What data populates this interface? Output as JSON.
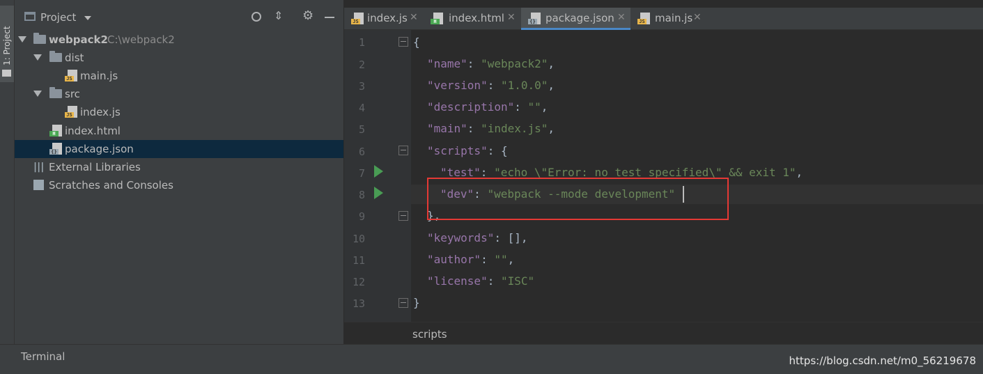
{
  "toolwindow": {
    "strip_label": "1: Project"
  },
  "project_panel": {
    "title": "Project",
    "tree": {
      "root": {
        "name": "webpack2",
        "path": "C:\\webpack2"
      },
      "dist_folder": "dist",
      "dist_main": "main.js",
      "src_folder": "src",
      "src_index": "index.js",
      "index_html": "index.html",
      "package_json": "package.json",
      "external_libraries": "External Libraries",
      "scratches": "Scratches and Consoles"
    }
  },
  "editor": {
    "tabs": [
      {
        "label": "index.js",
        "active": false
      },
      {
        "label": "index.html",
        "active": false
      },
      {
        "label": "package.json",
        "active": true
      },
      {
        "label": "main.js",
        "active": false
      }
    ],
    "line_numbers": [
      "1",
      "2",
      "3",
      "4",
      "5",
      "6",
      "7",
      "8",
      "9",
      "10",
      "11",
      "12",
      "13"
    ],
    "code": {
      "l1": "{",
      "l2_key": "\"name\"",
      "l2_val": "\"webpack2\"",
      "l3_key": "\"version\"",
      "l3_val": "\"1.0.0\"",
      "l4_key": "\"description\"",
      "l4_val": "\"\"",
      "l5_key": "\"main\"",
      "l5_val": "\"index.js\"",
      "l6_key": "\"scripts\"",
      "l7_key": "\"test\"",
      "l7_val": "\"echo \\\"Error: no test specified\\\" && exit 1\"",
      "l8_key": "\"dev\"",
      "l8_val": "\"webpack --mode development\"",
      "l9": "},",
      "l10_key": "\"keywords\"",
      "l11_key": "\"author\"",
      "l11_val": "\"\"",
      "l12_key": "\"license\"",
      "l12_val": "\"ISC\"",
      "l13": "}"
    },
    "breadcrumb": "scripts"
  },
  "bottom_bar": {
    "terminal": "Terminal",
    "watermark": "https://blog.csdn.net/m0_56219678"
  },
  "colors": {
    "highlight_box": "#e53935",
    "run_icon": "#499c54",
    "key": "#9876aa",
    "string": "#6a8759",
    "selection": "#0d293e"
  }
}
